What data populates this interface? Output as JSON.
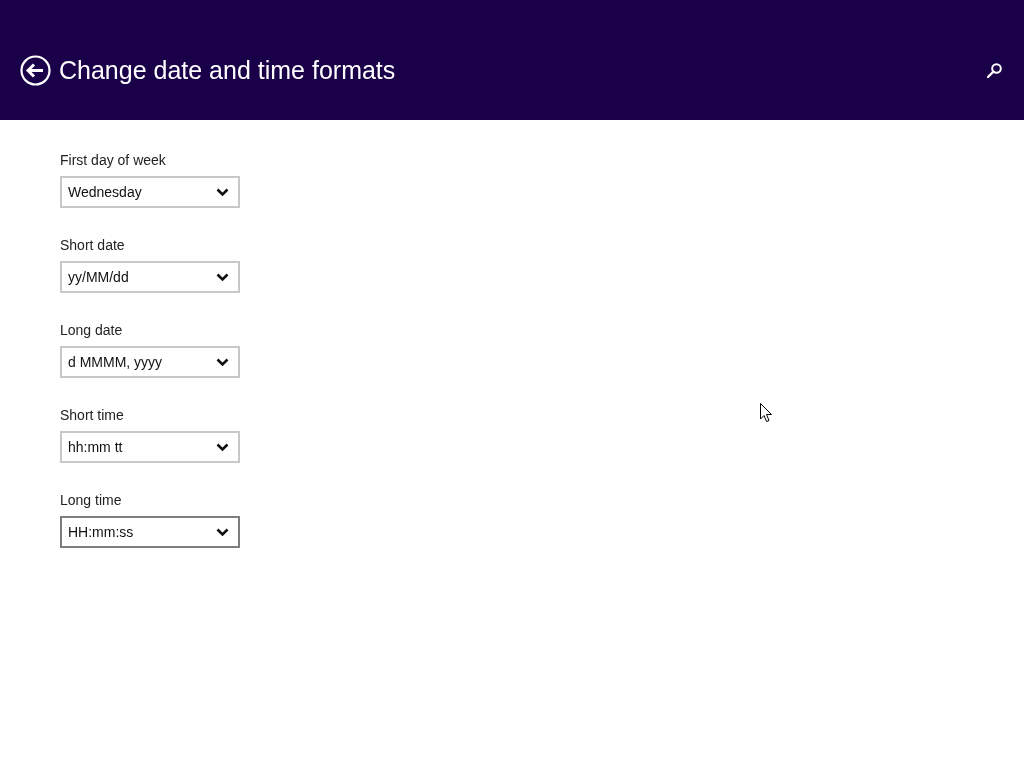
{
  "header": {
    "title": "Change date and time formats"
  },
  "settings": [
    {
      "label": "First day of week",
      "value": "Wednesday",
      "hovered": false
    },
    {
      "label": "Short date",
      "value": "yy/MM/dd",
      "hovered": false
    },
    {
      "label": "Long date",
      "value": "d MMMM, yyyy",
      "hovered": false
    },
    {
      "label": "Short time",
      "value": "hh:mm tt",
      "hovered": false
    },
    {
      "label": "Long time",
      "value": "HH:mm:ss",
      "hovered": true
    }
  ]
}
